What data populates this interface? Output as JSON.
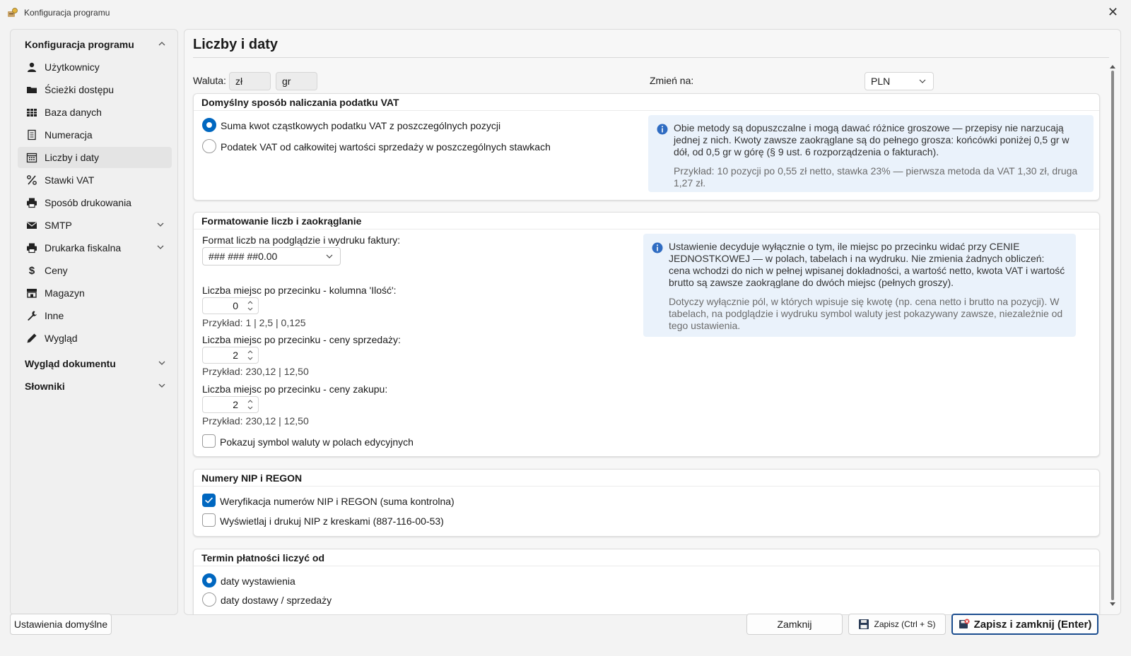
{
  "window": {
    "title": "Konfiguracja programu",
    "close_label": "✕"
  },
  "sidebar": {
    "section_main": "Konfiguracja programu",
    "items": [
      {
        "label": "Użytkownicy",
        "icon": "user-icon"
      },
      {
        "label": "Ścieżki dostępu",
        "icon": "folder-icon"
      },
      {
        "label": "Baza danych",
        "icon": "table-icon"
      },
      {
        "label": "Numeracja",
        "icon": "document-icon"
      },
      {
        "label": "Liczby i daty",
        "icon": "calendar-icon",
        "active": true
      },
      {
        "label": "Stawki VAT",
        "icon": "percent-icon"
      },
      {
        "label": "Sposób drukowania",
        "icon": "printer-icon"
      },
      {
        "label": "SMTP",
        "icon": "mail-icon"
      },
      {
        "label": "Drukarka fiskalna",
        "icon": "printer-icon"
      },
      {
        "label": "Ceny",
        "icon": "dollar-icon"
      },
      {
        "label": "Magazyn",
        "icon": "store-icon"
      },
      {
        "label": "Inne",
        "icon": "wrench-icon"
      },
      {
        "label": "Wygląd",
        "icon": "pen-icon"
      }
    ],
    "section_docs": "Wygląd dokumentu",
    "section_dicts": "Słowniki"
  },
  "page": {
    "title": "Liczby i daty",
    "currency_label": "Waluta:",
    "currency_main": "zł",
    "currency_sub": "gr",
    "change_to_label": "Zmień na:",
    "change_to_value": "PLN"
  },
  "vat_group": {
    "title": "Domyślny sposób naliczania podatku VAT",
    "option1": "Suma kwot cząstkowych podatku VAT z poszczególnych pozycji",
    "option2": "Podatek VAT od całkowitej wartości sprzedaży w poszczególnych stawkach",
    "selected": 1,
    "info_main": "Obie metody są dopuszczalne i mogą dawać różnice groszowe — przepisy nie narzucają jednej z nich. Kwoty zawsze zaokrąglane są do pełnego grosza: końcówki poniżej 0,5 gr w dół, od 0,5 gr w górę (§ 9 ust. 6 rozporządzenia o fakturach).",
    "info_example": "Przykład: 10 pozycji po 0,55 zł netto, stawka 23% — pierwsza metoda da VAT 1,30 zł, druga 1,27 zł."
  },
  "format_group": {
    "title": "Formatowanie liczb i zaokrąglanie",
    "format_label": "Format liczb na podglądzie i wydruku faktury:",
    "format_value": "### ### ##0.00",
    "qty_label": "Liczba miejsc po przecinku - kolumna 'Ilość':",
    "qty_value": "0",
    "qty_example": "Przykład: 1   |   2,5   |   0,125",
    "sale_label": "Liczba miejsc po przecinku - ceny sprzedaży:",
    "sale_value": "2",
    "sale_example": "Przykład: 230,12   |   12,50",
    "purchase_label": "Liczba miejsc po przecinku - ceny zakupu:",
    "purchase_value": "2",
    "purchase_example": "Przykład: 230,12   |   12,50",
    "show_symbol_label": "Pokazuj symbol waluty w polach edycyjnych",
    "show_symbol_checked": false,
    "info_main": "Ustawienie decyduje wyłącznie o tym, ile miejsc po przecinku widać przy CENIE JEDNOSTKOWEJ — w polach, tabelach i na wydruku. Nie zmienia żadnych obliczeń: cena wchodzi do nich w pełnej wpisanej dokładności, a wartość netto, kwota VAT i wartość brutto są zawsze zaokrąglane do dwóch miejsc (pełnych groszy).",
    "info_secondary": "Dotyczy wyłącznie pól, w których wpisuje się kwotę (np. cena netto i brutto na pozycji). W tabelach, na podglądzie i wydruku symbol waluty jest pokazywany zawsze, niezależnie od tego ustawienia."
  },
  "nip_group": {
    "title": "Numery NIP i REGON",
    "verify_label": "Weryfikacja numerów NIP i REGON (suma kontrolna)",
    "verify_checked": true,
    "dashes_label": "Wyświetlaj i drukuj NIP z kreskami (887-116-00-53)",
    "dashes_checked": false
  },
  "payment_group": {
    "title": "Termin płatności liczyć od",
    "option1": "daty wystawienia",
    "option2": "daty dostawy / sprzedaży",
    "selected": 1
  },
  "footer": {
    "defaults": "Ustawienia domyślne",
    "close": "Zamknij",
    "save": "Zapisz (Ctrl + S)",
    "save_close": "Zapisz i zamknij (Enter)"
  },
  "colors": {
    "accent": "#0067c0",
    "info_bg": "#eaf2fb",
    "primary_border": "#1b4d8f"
  }
}
